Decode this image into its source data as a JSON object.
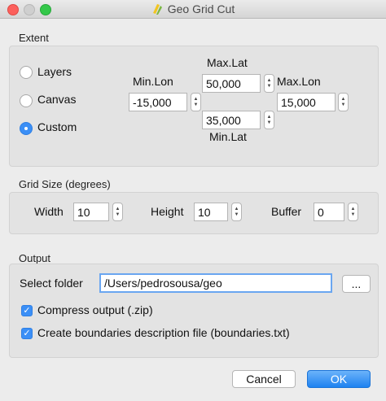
{
  "window": {
    "title": "Geo Grid Cut"
  },
  "extent": {
    "title": "Extent",
    "options": [
      {
        "label": "Layers",
        "selected": false
      },
      {
        "label": "Canvas",
        "selected": false
      },
      {
        "label": "Custom",
        "selected": true
      }
    ],
    "max_lat": {
      "label": "Max.Lat",
      "value": "50,000"
    },
    "min_lon": {
      "label": "Min.Lon",
      "value": "-15,000"
    },
    "max_lon": {
      "label": "Max.Lon",
      "value": "15,000"
    },
    "min_lat": {
      "label": "Min.Lat",
      "value": "35,000"
    }
  },
  "grid": {
    "title": "Grid Size (degrees)",
    "width": {
      "label": "Width",
      "value": "10"
    },
    "height": {
      "label": "Height",
      "value": "10"
    },
    "buffer": {
      "label": "Buffer",
      "value": "0"
    }
  },
  "output": {
    "title": "Output",
    "folder_label": "Select folder",
    "folder_value": "/Users/pedrosousa/geo",
    "browse_label": "...",
    "compress": {
      "label": "Compress output (.zip)",
      "checked": true
    },
    "boundaries": {
      "label": "Create boundaries description file (boundaries.txt)",
      "checked": true
    }
  },
  "buttons": {
    "cancel": "Cancel",
    "ok": "OK"
  },
  "colors": {
    "accent": "#3b8ff6",
    "close": "#fc605c",
    "zoom": "#34c84a"
  }
}
